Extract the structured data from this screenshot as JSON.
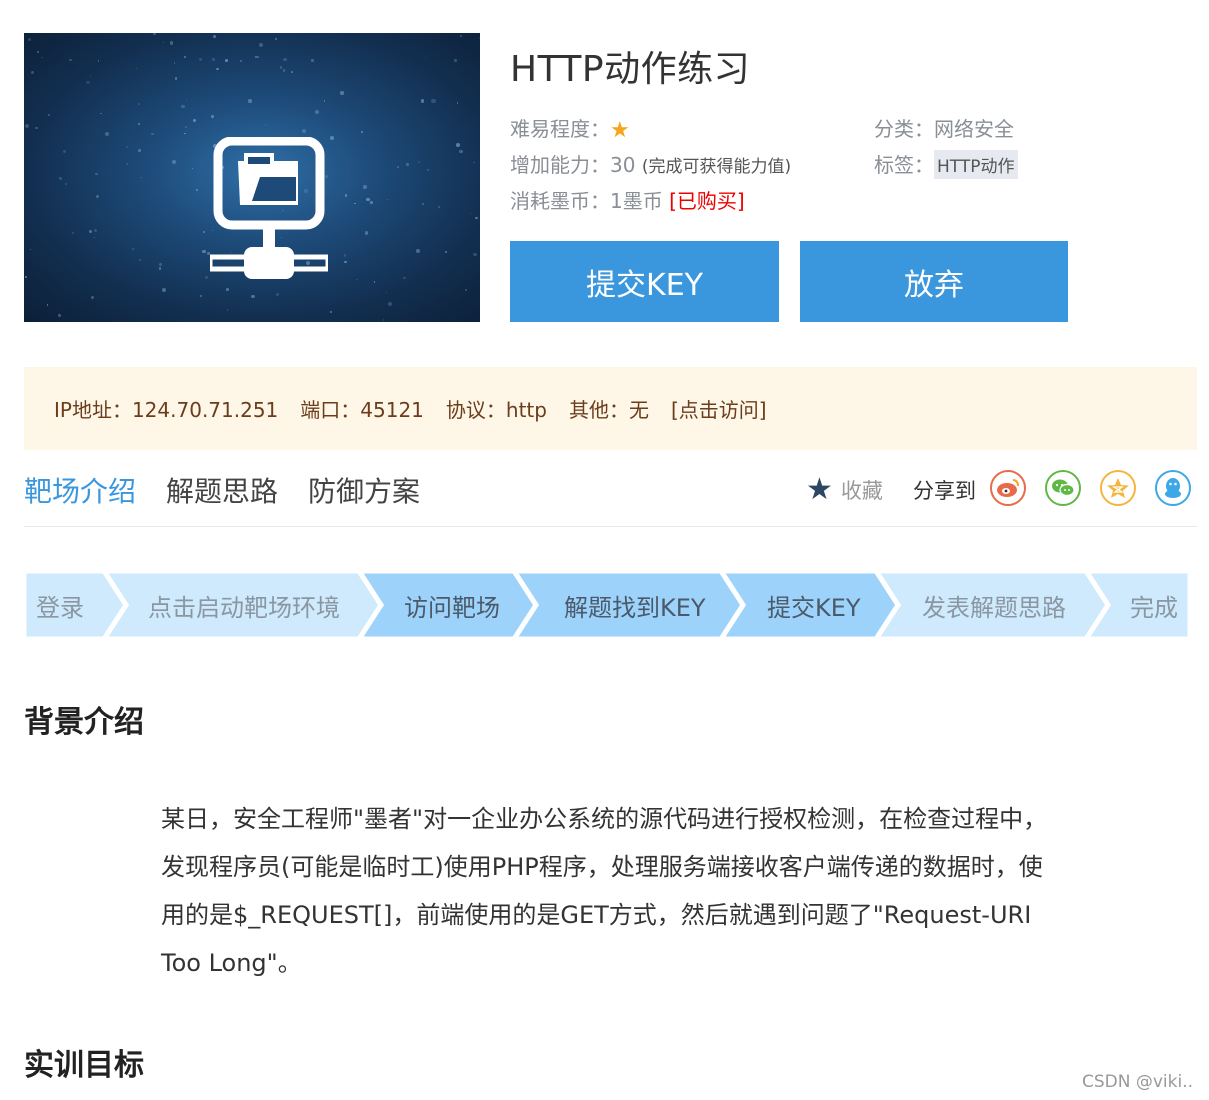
{
  "header": {
    "title": "HTTP动作练习",
    "difficulty_label": "难易程度：",
    "category_label": "分类：",
    "category_value": "网络安全",
    "ability_label": "增加能力：",
    "ability_value": "30",
    "ability_note": "(完成可获得能力值)",
    "tag_label": "标签：",
    "tag_value": "HTTP动作",
    "cost_label": "消耗墨币：",
    "cost_value": "1墨币",
    "purchased": "[已购买]",
    "submit_button": "提交KEY",
    "abandon_button": "放弃",
    "image_icon": "server-monitor-icon"
  },
  "infobar": {
    "ip": "IP地址：124.70.71.251",
    "port": "端口：45121",
    "protocol": "协议：http",
    "other": "其他：无",
    "visit_link": "[点击访问]"
  },
  "tabs": [
    {
      "label": "靶场介绍",
      "active": true
    },
    {
      "label": "解题思路",
      "active": false
    },
    {
      "label": "防御方案",
      "active": false
    }
  ],
  "actions": {
    "favorite": "收藏",
    "share_to": "分享到",
    "share_icons": [
      "weibo-icon",
      "wechat-icon",
      "qzone-icon",
      "qq-icon"
    ]
  },
  "steps": [
    {
      "label": "登录",
      "state": "pending"
    },
    {
      "label": "点击启动靶场环境",
      "state": "pending"
    },
    {
      "label": "访问靶场",
      "state": "done"
    },
    {
      "label": "解题找到KEY",
      "state": "done"
    },
    {
      "label": "提交KEY",
      "state": "done"
    },
    {
      "label": "发表解题思路",
      "state": "pending"
    },
    {
      "label": "完成",
      "state": "pending"
    }
  ],
  "content": {
    "background_heading": "背景介绍",
    "background_text": "某日，安全工程师\"墨者\"对一企业办公系统的源代码进行授权检测，在检查过程中，发现程序员(可能是临时工)使用PHP程序，处理服务端接收客户端传递的数据时，使用的是$_REQUEST[]，前端使用的是GET方式，然后就遇到问题了\"Request-URI Too Long\"。",
    "objective_heading": "实训目标"
  },
  "watermark": "CSDN @viki..",
  "colors": {
    "accent": "#3b97dd",
    "infobar_bg": "#fef6e6",
    "step_done": "#9dd3fb",
    "step_pending": "#cfeafd"
  }
}
